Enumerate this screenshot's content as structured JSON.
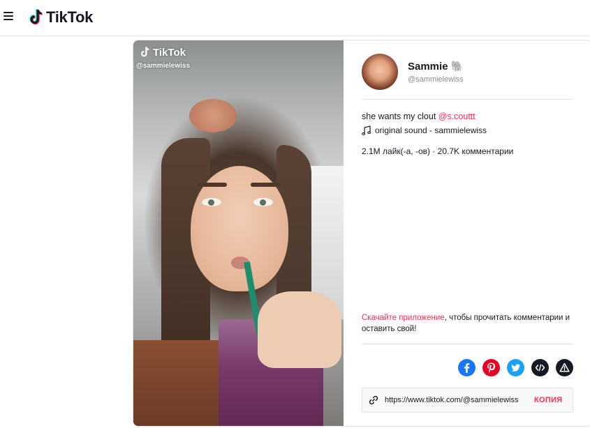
{
  "header": {
    "logo_text": "TikTok",
    "menu_icon": "hamburger-menu-icon"
  },
  "video": {
    "watermark_logo": "TikTok",
    "watermark_handle": "@sammielewiss"
  },
  "author": {
    "name": "Sammie 🐘",
    "handle": "@sammielewiss"
  },
  "post": {
    "caption": "she wants my clout ",
    "mention": "@s.couttt",
    "sound": "original sound - sammielewiss",
    "stats": "2.1M лайк(-а, -ов) · 20.7K комментарии"
  },
  "cta": {
    "link_text": "Скачайте приложение",
    "rest_text": ", чтобы прочитать комментарии и оставить свой!"
  },
  "share": {
    "buttons": [
      "facebook-icon",
      "pinterest-icon",
      "twitter-icon",
      "embed-icon",
      "report-icon"
    ]
  },
  "link_box": {
    "url": "https://www.tiktok.com/@sammielewiss",
    "copy_label": "КОПИЯ"
  },
  "colors": {
    "accent": "#fe2c55",
    "facebook": "#1877f2",
    "pinterest": "#e60023",
    "twitter": "#1da1f2",
    "dark": "#161823"
  }
}
